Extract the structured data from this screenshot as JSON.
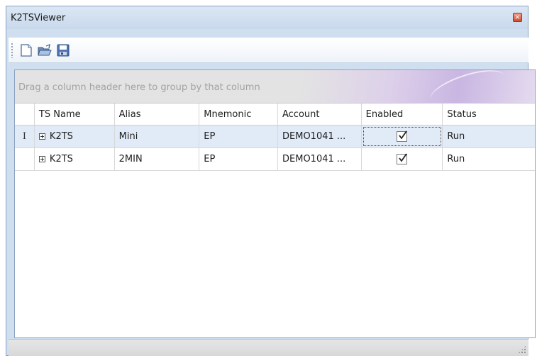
{
  "window": {
    "title": "K2TSViewer",
    "close_icon": "close-icon"
  },
  "toolbar": {
    "buttons": [
      {
        "name": "new-document-button",
        "icon": "new-document-icon"
      },
      {
        "name": "open-folder-button",
        "icon": "open-folder-icon"
      },
      {
        "name": "save-button",
        "icon": "save-icon"
      }
    ]
  },
  "grid": {
    "group_panel_text": "Drag a column header here to group by that column",
    "columns": [
      "TS Name",
      "Alias",
      "Mnemonic",
      "Account",
      "Enabled",
      "Status"
    ],
    "rows": [
      {
        "indicator": "I",
        "ts_name": "K2TS",
        "alias": "Mini",
        "mnemonic": "EP",
        "account": "DEMO1041 ...",
        "enabled": true,
        "status": "Run",
        "selected": true
      },
      {
        "indicator": "",
        "ts_name": "K2TS",
        "alias": "2MIN",
        "mnemonic": "EP",
        "account": "DEMO1041 ...",
        "enabled": true,
        "status": "Run",
        "selected": false
      }
    ]
  },
  "colors": {
    "window_bg": "#cfdff0",
    "selected_row": "#e1ebf8",
    "group_panel_text": "#a2a2a2"
  }
}
